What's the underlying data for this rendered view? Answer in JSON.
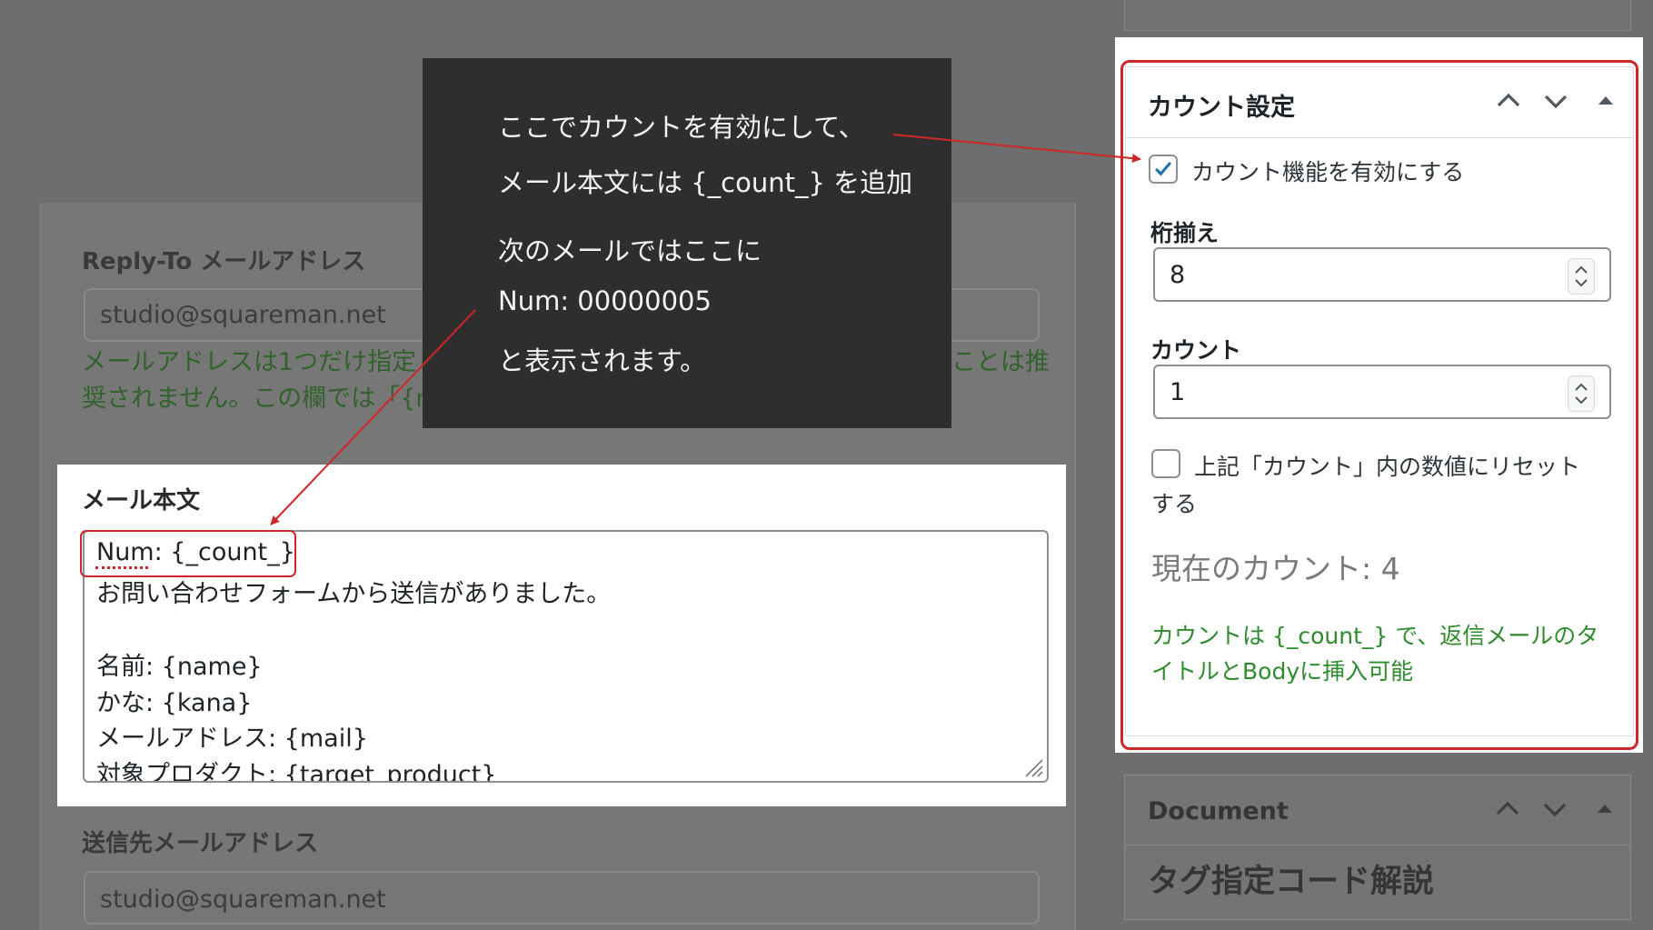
{
  "form": {
    "reply_to_label": "Reply-To メールアドレス",
    "reply_to_value": "studio@squareman.net",
    "reply_to_help_line1": "メールアドレスは1つだけ指定してください。",
    "reply_to_help_line1_end": "ことは推",
    "reply_to_help_line2": "奨されません。この欄では「{ma",
    "body_label": "メール本文",
    "body_lines": [
      "Num: {_count_}",
      "お問い合わせフォームから送信がありました。",
      "",
      "名前: {name}",
      "かな: {kana}",
      "メールアドレス: {mail}",
      "対象プロダクト: {target_product}"
    ],
    "to_label": "送信先メールアドレス",
    "to_value": "studio@squareman.net"
  },
  "tooltip": {
    "lines": [
      "ここでカウントを有効にして、",
      "メール本文には {_count_} を追加",
      "次のメールではここに",
      "Num: 00000005",
      "と表示されます。"
    ]
  },
  "count_panel": {
    "title": "カウント設定",
    "enable_label": "カウント機能を有効にする",
    "enable_checked": true,
    "digits_label": "桁揃え",
    "digits_value": "8",
    "count_label": "カウント",
    "count_value": "1",
    "reset_label_line1": "上記「カウント」内の数値にリセット",
    "reset_label_line2": "する",
    "reset_checked": false,
    "current_count": "現在のカウント: 4",
    "help_line1": "カウントは {_count_} で、返信メールのタ",
    "help_line2": "イトルとBodyに挿入可能"
  },
  "document_panel": {
    "title": "Document",
    "heading": "タグ指定コード解説"
  },
  "colors": {
    "annotation_red": "#d0262b",
    "help_green": "#2e8b2e",
    "checkbox_blue": "#2271b1"
  }
}
